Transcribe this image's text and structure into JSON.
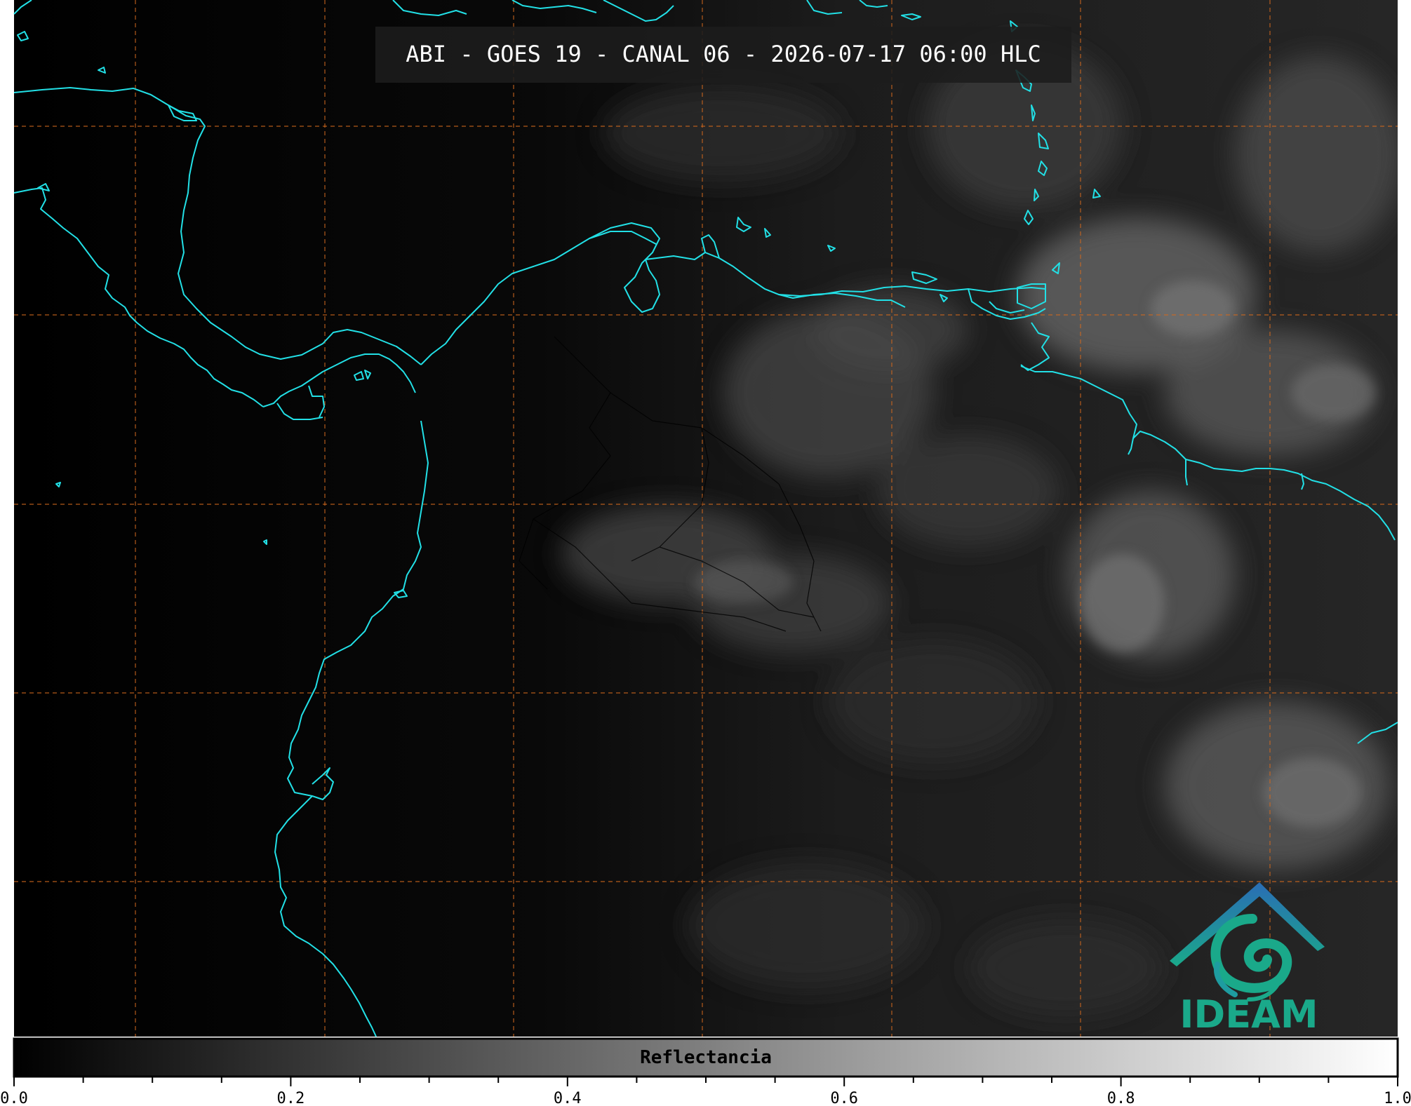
{
  "title": "ABI - GOES 19 - CANAL 06 - 2026-07-17 06:00 HLC",
  "colorbar": {
    "label": "Reflectancia",
    "min": 0.0,
    "max": 1.0,
    "major_ticks": [
      "0.0",
      "0.2",
      "0.4",
      "0.6",
      "0.8",
      "1.0"
    ],
    "minor_count_between_majors": 3
  },
  "logo": {
    "text": "IDEAM"
  },
  "colors": {
    "coastline": "#22e0e6",
    "gridline": "#d2691e",
    "logo_blue": "#2a6db5",
    "logo_green": "#1aa98a"
  }
}
